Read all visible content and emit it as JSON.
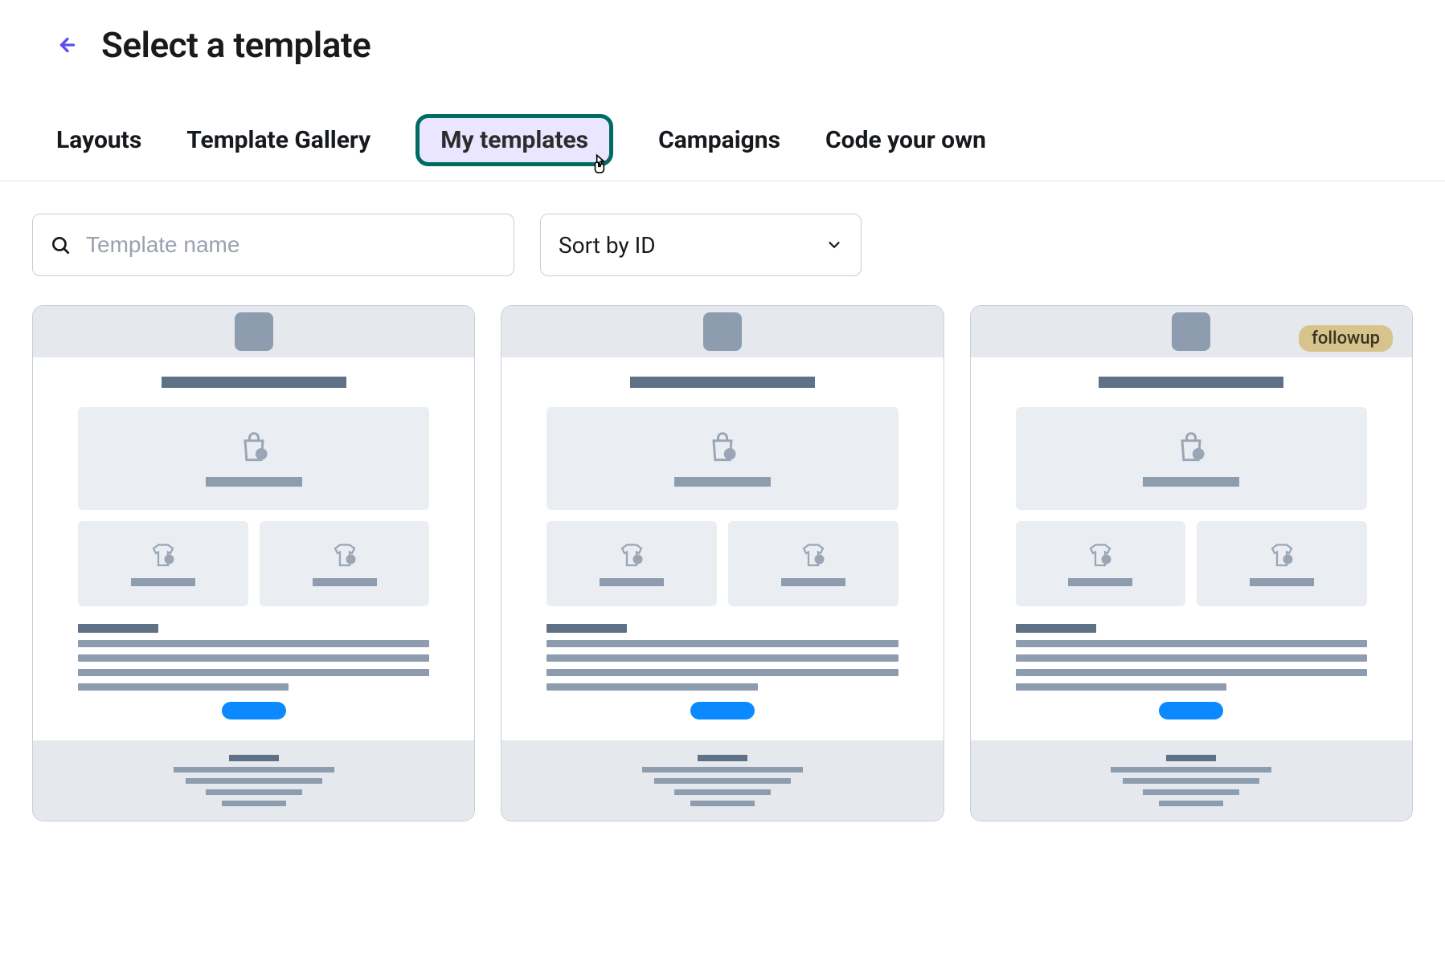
{
  "header": {
    "title": "Select a template"
  },
  "tabs": [
    {
      "label": "Layouts",
      "active": false
    },
    {
      "label": "Template Gallery",
      "active": false
    },
    {
      "label": "My templates",
      "active": true
    },
    {
      "label": "Campaigns",
      "active": false
    },
    {
      "label": "Code your own",
      "active": false
    }
  ],
  "search": {
    "placeholder": "Template name",
    "value": ""
  },
  "sort": {
    "label": "Sort by ID"
  },
  "templates": [
    {
      "tag": null
    },
    {
      "tag": null
    },
    {
      "tag": "followup"
    }
  ]
}
